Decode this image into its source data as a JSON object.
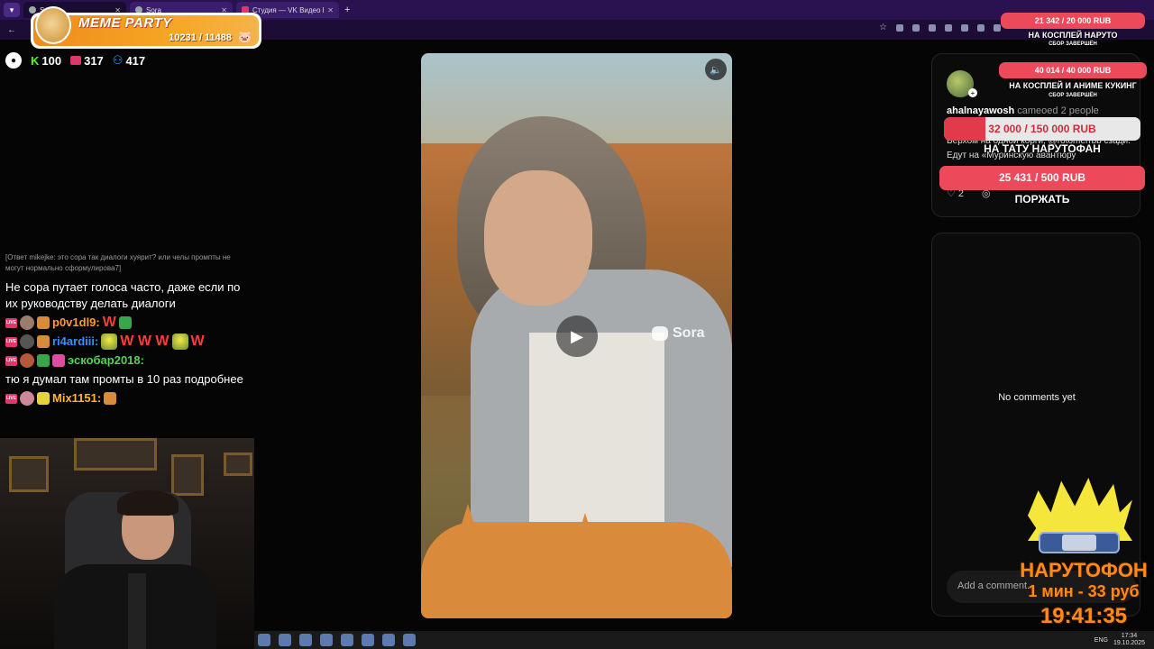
{
  "browser": {
    "tabs": [
      {
        "label": "Sora",
        "active": true
      },
      {
        "label": "Sora",
        "active": false
      },
      {
        "label": "Студия — VK Видео Live",
        "active": false
      }
    ]
  },
  "meme_party": {
    "title": "MEME PARTY",
    "count": "10231 / 11488"
  },
  "stats": {
    "kick": "100",
    "vk": "317",
    "viewers": "417"
  },
  "chat": {
    "reply": "[Ответ mikejke: это сора так диалоги хуярит? или челы промпты не могут нормально сформулирова7]",
    "first_message": "Не сора путает голоса часто, даже если по их руководству делать диалоги",
    "messages": [
      {
        "nick": "p0v1dl9:",
        "text": "W"
      },
      {
        "nick": "ri4ardiii:",
        "text": "W W W"
      },
      {
        "nick": "эскобар2018:",
        "text": "тю я думал там промты в 10 раз подробнее"
      },
      {
        "nick": "Mix1151:",
        "text": ""
      }
    ],
    "W": "W"
  },
  "video": {
    "watermark": "Sora"
  },
  "post": {
    "username": "ahalnayawosh",
    "cameo_text": "cameoed 2 people",
    "text": "Верхом на одной корги, @rotomerrbb сзади. Едут на «Муринскую авантюру",
    "likes": "2"
  },
  "comments": {
    "empty": "No comments yet",
    "placeholder": "Add a comment..."
  },
  "goals": [
    {
      "amount": "21 342 / 20 000 RUB",
      "title": "НА КОСПЛЕЙ НАРУТО",
      "sub": "СБОР ЗАВЕРШЁН",
      "progress": 1.0
    },
    {
      "amount": "40 014 / 40 000 RUB",
      "title": "НА КОСПЛЕЙ И АНИМЕ КУКИНГ",
      "sub": "СБОР ЗАВЕРШЁН",
      "progress": 1.0
    },
    {
      "amount": "32 000 / 150 000 RUB",
      "title": "НА ТАТУ НАРУТОФАН",
      "sub": "",
      "progress": 0.213
    },
    {
      "amount": "25 431 / 500 RUB",
      "title": "ПОРЖАТЬ",
      "sub": "",
      "progress": 1.0
    }
  ],
  "narutofon": {
    "title": "НАРУТОФОН",
    "rate": "1 мин - 33 руб",
    "timer": "19:41:35"
  },
  "taskbar": {
    "lang": "ENG",
    "time": "17:34",
    "date": "19.10.2025"
  },
  "colors": {
    "accent": "#e23a4a",
    "browser": "#2a1150",
    "naruto": "#ff8a1a"
  }
}
